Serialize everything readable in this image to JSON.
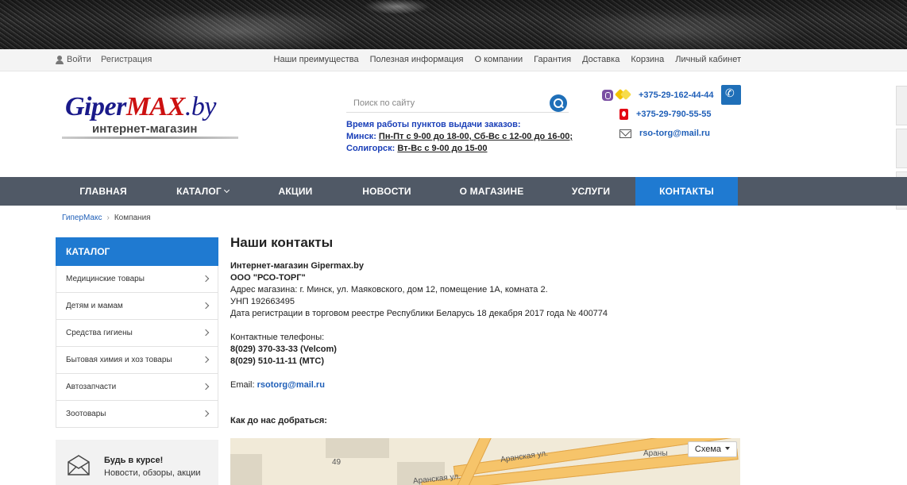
{
  "topbar": {
    "login": "Войти",
    "register": "Регистрация",
    "links": [
      "Наши преимущества",
      "Полезная информация",
      "О компании",
      "Гарантия",
      "Доставка",
      "Корзина",
      "Личный кабинет"
    ]
  },
  "logo": {
    "part1": "Giper",
    "part2": "MAX",
    "part3": ".by",
    "tagline": "интернет-магазин"
  },
  "search": {
    "placeholder": "Поиск по сайту"
  },
  "hours": {
    "title": "Время работы пунктов выдачи заказов:",
    "minsk_label": "Минск:",
    "minsk_text": "Пн-Пт с 9-00 до 18-00, Сб-Вс с 12-00 до 16-00;",
    "soligorsk_label": "Солигорск:",
    "soligorsk_text": "Вт-Вс с 9-00 до 15-00"
  },
  "contacts": {
    "phone1": "+375-29-162-44-44",
    "phone2": "+375-29-790-55-55",
    "email": "rso-torg@mail.ru"
  },
  "nav": [
    "ГЛАВНАЯ",
    "КАТАЛОГ",
    "АКЦИИ",
    "НОВОСТИ",
    "О МАГАЗИНЕ",
    "УСЛУГИ",
    "КОНТАКТЫ"
  ],
  "breadcrumb": {
    "home": "ГиперМакс",
    "current": "Компания"
  },
  "sidebar": {
    "title": "КАТАЛОГ",
    "items": [
      "Медицинские товары",
      "Детям и мамам",
      "Средства гигиены",
      "Бытовая химия и хоз товары",
      "Автозапчасти",
      "Зоотовары"
    ]
  },
  "news": {
    "title": "Будь в курсе!",
    "subtitle": "Новости, обзоры, акции"
  },
  "content": {
    "heading": "Наши контакты",
    "store": "Интернет-магазин Gipermax.by",
    "company": "ООО \"РСО-ТОРГ\"",
    "address": "Адрес магазина: г. Минск, ул. Маяковского, дом 12, помещение 1А, комната 2.",
    "unp": "УНП 192663495",
    "registration": "Дата регистрации в торговом реестре Республики Беларусь 18 декабря 2017 года № 400774",
    "phones_label": "Контактные телефоны:",
    "phone_velcom": "8(029) 370-33-33 (Velcom)",
    "phone_mts": "8(029) 510-11-11 (МТС)",
    "email_label": "Email:",
    "email": "rsotorg@mail.ru",
    "directions": "Как до нас добраться:"
  },
  "map": {
    "scheme": "Схема",
    "street1": "Аранская ул.",
    "street2": "Аранская ул.",
    "street3": "Араны",
    "number": "49"
  }
}
